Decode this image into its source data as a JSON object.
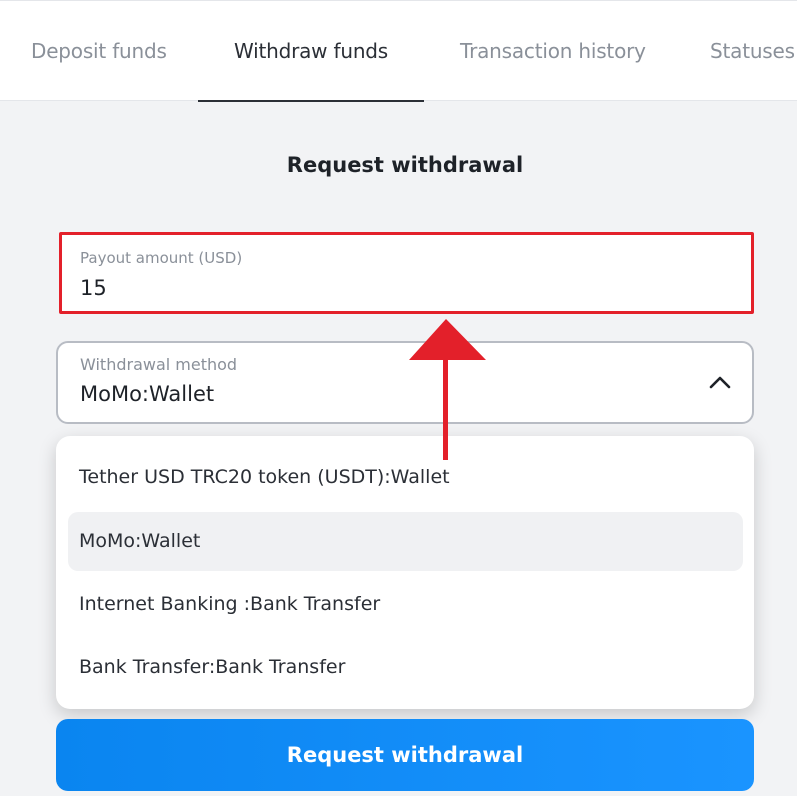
{
  "tabs": [
    {
      "label": "Deposit funds",
      "active": false
    },
    {
      "label": "Withdraw funds",
      "active": true
    },
    {
      "label": "Transaction history",
      "active": false
    },
    {
      "label": "Statuses",
      "active": false
    }
  ],
  "form": {
    "title": "Request withdrawal",
    "amount": {
      "label": "Payout amount (USD)",
      "value": "15"
    },
    "method": {
      "label": "Withdrawal method",
      "value": "MoMo:Wallet",
      "expanded": true
    },
    "options": [
      {
        "label": "Tether USD TRC20 token (USDT):Wallet",
        "selected": false
      },
      {
        "label": "MoMo:Wallet",
        "selected": true
      },
      {
        "label": "Internet Banking :Bank Transfer",
        "selected": false
      },
      {
        "label": "Bank Transfer:Bank Transfer",
        "selected": false
      }
    ],
    "submit_label": "Request withdrawal"
  },
  "icons": {
    "method_toggle": "chevron-up-icon",
    "annotation": "arrow-up-icon"
  },
  "colors": {
    "highlight": "#e3202a",
    "primary_button": "#0a85f0"
  }
}
